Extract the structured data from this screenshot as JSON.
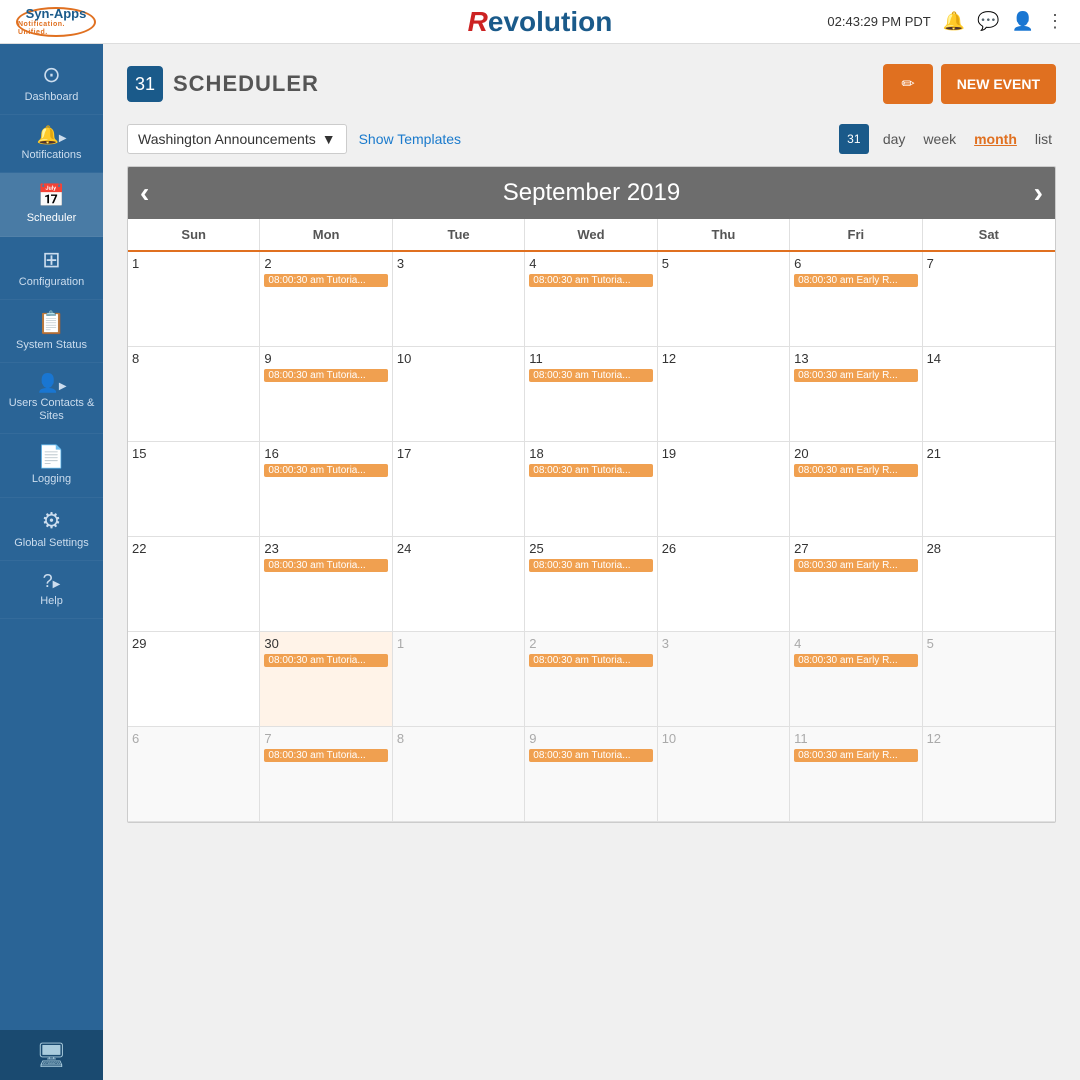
{
  "header": {
    "logo_top": "Syn-Apps",
    "logo_sub": "Notification. Unified.",
    "center_logo": "Revolution",
    "time": "02:43:29 PM PDT"
  },
  "sidebar": {
    "items": [
      {
        "id": "dashboard",
        "label": "Dashboard",
        "icon": "⊙"
      },
      {
        "id": "notifications",
        "label": "Notifications",
        "icon": "🔔"
      },
      {
        "id": "scheduler",
        "label": "Scheduler",
        "icon": "📅",
        "active": true
      },
      {
        "id": "configuration",
        "label": "Configuration",
        "icon": "⊞"
      },
      {
        "id": "system-status",
        "label": "System Status",
        "icon": "📋"
      },
      {
        "id": "users-contacts-sites",
        "label": "Users Contacts & Sites",
        "icon": "👤"
      },
      {
        "id": "logging",
        "label": "Logging",
        "icon": "📄"
      },
      {
        "id": "global-settings",
        "label": "Global Settings",
        "icon": "⚙"
      },
      {
        "id": "help",
        "label": "Help",
        "icon": "?"
      }
    ],
    "bottom_icon": "🖥"
  },
  "scheduler": {
    "title": "SCHEDULER",
    "edit_label": "✏",
    "new_event_label": "NEW EVENT",
    "dropdown": {
      "selected": "Washington Announcements"
    },
    "show_templates": "Show Templates",
    "views": {
      "day": "day",
      "week": "week",
      "month": "month",
      "list": "list",
      "active": "month"
    },
    "calendar": {
      "month_title": "September 2019",
      "days_of_week": [
        "Sun",
        "Mon",
        "Tue",
        "Wed",
        "Thu",
        "Fri",
        "Sat"
      ],
      "weeks": [
        [
          {
            "num": "1",
            "other": false,
            "events": []
          },
          {
            "num": "2",
            "other": false,
            "events": [
              "08:00:30 am Tutoria..."
            ]
          },
          {
            "num": "3",
            "other": false,
            "events": []
          },
          {
            "num": "4",
            "other": false,
            "events": [
              "08:00:30 am Tutoria..."
            ]
          },
          {
            "num": "5",
            "other": false,
            "events": []
          },
          {
            "num": "6",
            "other": false,
            "events": [
              "08:00:30 am Early R..."
            ]
          },
          {
            "num": "7",
            "other": false,
            "events": []
          }
        ],
        [
          {
            "num": "8",
            "other": false,
            "events": []
          },
          {
            "num": "9",
            "other": false,
            "events": [
              "08:00:30 am Tutoria..."
            ]
          },
          {
            "num": "10",
            "other": false,
            "events": []
          },
          {
            "num": "11",
            "other": false,
            "events": [
              "08:00:30 am Tutoria..."
            ]
          },
          {
            "num": "12",
            "other": false,
            "events": []
          },
          {
            "num": "13",
            "other": false,
            "events": [
              "08:00:30 am Early R..."
            ]
          },
          {
            "num": "14",
            "other": false,
            "events": []
          }
        ],
        [
          {
            "num": "15",
            "other": false,
            "events": []
          },
          {
            "num": "16",
            "other": false,
            "events": [
              "08:00:30 am Tutoria..."
            ]
          },
          {
            "num": "17",
            "other": false,
            "events": []
          },
          {
            "num": "18",
            "other": false,
            "events": [
              "08:00:30 am Tutoria..."
            ]
          },
          {
            "num": "19",
            "other": false,
            "events": []
          },
          {
            "num": "20",
            "other": false,
            "events": [
              "08:00:30 am Early R..."
            ]
          },
          {
            "num": "21",
            "other": false,
            "events": []
          }
        ],
        [
          {
            "num": "22",
            "other": false,
            "events": []
          },
          {
            "num": "23",
            "other": false,
            "events": [
              "08:00:30 am Tutoria..."
            ]
          },
          {
            "num": "24",
            "other": false,
            "events": []
          },
          {
            "num": "25",
            "other": false,
            "events": [
              "08:00:30 am Tutoria..."
            ]
          },
          {
            "num": "26",
            "other": false,
            "events": []
          },
          {
            "num": "27",
            "other": false,
            "events": [
              "08:00:30 am Early R..."
            ]
          },
          {
            "num": "28",
            "other": false,
            "events": []
          }
        ],
        [
          {
            "num": "29",
            "other": false,
            "today": false,
            "events": []
          },
          {
            "num": "30",
            "other": false,
            "today": true,
            "events": [
              "08:00:30 am Tutoria..."
            ]
          },
          {
            "num": "1",
            "other": true,
            "events": []
          },
          {
            "num": "2",
            "other": true,
            "events": [
              "08:00:30 am Tutoria..."
            ]
          },
          {
            "num": "3",
            "other": true,
            "events": []
          },
          {
            "num": "4",
            "other": true,
            "events": [
              "08:00:30 am Early R..."
            ]
          },
          {
            "num": "5",
            "other": true,
            "events": []
          }
        ],
        [
          {
            "num": "6",
            "other": true,
            "events": []
          },
          {
            "num": "7",
            "other": true,
            "events": [
              "08:00:30 am Tutoria..."
            ]
          },
          {
            "num": "8",
            "other": true,
            "events": []
          },
          {
            "num": "9",
            "other": true,
            "events": [
              "08:00:30 am Tutoria..."
            ]
          },
          {
            "num": "10",
            "other": true,
            "events": []
          },
          {
            "num": "11",
            "other": true,
            "events": [
              "08:00:30 am Early R..."
            ]
          },
          {
            "num": "12",
            "other": true,
            "events": []
          }
        ]
      ]
    }
  }
}
